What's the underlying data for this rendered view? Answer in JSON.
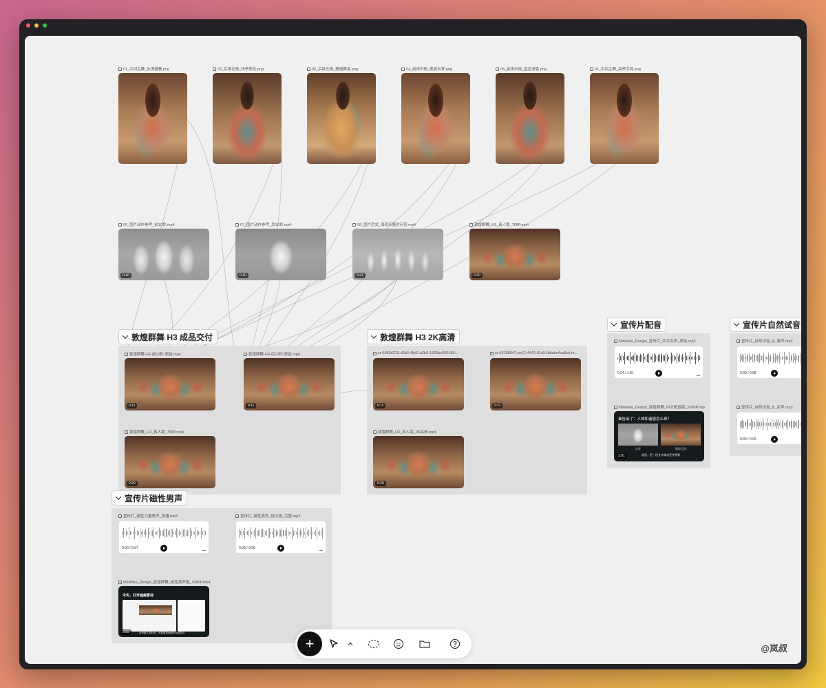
{
  "top_row": [
    {
      "name": "01_中间主舞_反弹琵琶.png"
    },
    {
      "name": "02_后排左侧_托举莲花.png"
    },
    {
      "name": "03_后排左侧_飘逸舞姿.png"
    },
    {
      "name": "04_前排右侧_跪姿合掌.png"
    },
    {
      "name": "05_前排右侧_盘坐凝香.png"
    },
    {
      "name": "01_中间主舞_高举手臂.png"
    }
  ],
  "video_row": [
    {
      "name": "06_图片动作参考_前10秒.mp4",
      "duration": "0:10"
    },
    {
      "name": "07_图片动作参考_后10秒.mp4",
      "duration": "0:10"
    },
    {
      "name": "08_图片范式_海浪乐器对问答.mp4",
      "duration": "0:21"
    },
    {
      "name": "敦煌群舞_H3_真人版_768P.mp4",
      "duration": "0:20"
    }
  ],
  "group_deliver": {
    "title": "敦煌群舞 H3 成品交付",
    "items": [
      {
        "name": "敦煌群舞-H3-前10秒-原始.mp4",
        "duration": "0:11"
      },
      {
        "name": "敦煌群舞-H3-后10秒-原始.mp4",
        "duration": "0:11"
      },
      {
        "name": "敦煌群舞_H3_真人版_768P.mp4",
        "duration": "0:20"
      }
    ]
  },
  "group_2k": {
    "title": "敦煌群舞 H3 2K高清",
    "items": [
      {
        "name": "sr-6983d215-d3b3-4bb2-a2b5-1836be300189...",
        "duration": "0:11"
      },
      {
        "name": "sr-43108647-ae12-4442-81e5-fbbabe4ca8cd.m...",
        "duration": "0:11"
      },
      {
        "name": "敦煌群舞_H3_真人版_2K高清.mp4",
        "duration": "0:20"
      }
    ]
  },
  "group_narration": {
    "title": "宣传片配音",
    "audio": {
      "name": "MiniMax_Design_宣传片_中文女声_原始.mp3",
      "time": "0:24",
      "total": "1:01"
    },
    "video": {
      "name": "MiniMax_Design_敦煌群舞_中文配音版_1080P.mp4",
      "caption": "谁告诉了：人体和谐感怎么来？",
      "left_label": "出发",
      "right_label": "最终品质",
      "subtitle": "就是，把一段文字做成宣传视频",
      "time": "1:01"
    }
  },
  "group_natural": {
    "title": "宣传片自然试音",
    "audio": [
      {
        "name": "宣传片_自然试音_A_真声.mp3",
        "time": "0:00",
        "total": "0:08"
      },
      {
        "name": "宣传片_自然试音_B_女声.mp3",
        "time": "0:00",
        "total": "0:09"
      }
    ]
  },
  "group_male": {
    "title": "宣传片磁性男声",
    "audio": [
      {
        "name": "宣传片_磁性力量男声_演播.mp3",
        "time": "0:00",
        "total": "0:07"
      },
      {
        "name": "宣传片_磁性男声_低沉版_完整.mp3",
        "time": "0:00",
        "total": "0:59"
      }
    ],
    "video": {
      "name": "MiniMax_Design_敦煌群舞_磁性男声版_1080P.mp4",
      "title": "今天，打开画廊素材",
      "subtitle": "用来做人物分析，也要看到画面的色调变化",
      "time": "0:59"
    }
  },
  "toolbar": {
    "add": "+",
    "items": [
      "pointer-icon",
      "chevron-up-icon",
      "lasso-icon",
      "sticker-icon",
      "folder-icon",
      "help-icon"
    ]
  },
  "watermark": "@岚叔"
}
